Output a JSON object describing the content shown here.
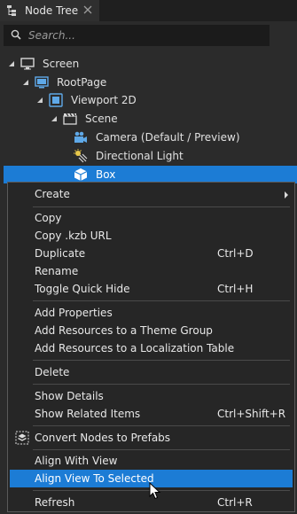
{
  "tab": {
    "title": "Node Tree"
  },
  "search": {
    "placeholder": "Search..."
  },
  "tree": [
    {
      "label": "Screen",
      "icon": "monitor-icon"
    },
    {
      "label": "RootPage",
      "icon": "page-icon"
    },
    {
      "label": "Viewport 2D",
      "icon": "viewport-icon"
    },
    {
      "label": "Scene",
      "icon": "scene-icon"
    },
    {
      "label": "Camera (Default / Preview)",
      "icon": "camera-icon"
    },
    {
      "label": "Directional Light",
      "icon": "light-icon"
    },
    {
      "label": "Box",
      "icon": "box-icon",
      "selected": true
    }
  ],
  "menu": {
    "create": "Create",
    "copy": "Copy",
    "copy_kzb_url": "Copy .kzb URL",
    "duplicate": "Duplicate",
    "duplicate_shortcut": "Ctrl+D",
    "rename": "Rename",
    "toggle_quick_hide": "Toggle Quick Hide",
    "toggle_quick_hide_shortcut": "Ctrl+H",
    "add_properties": "Add Properties",
    "add_resources_theme": "Add Resources to a Theme Group",
    "add_resources_localization": "Add Resources to a Localization Table",
    "delete": "Delete",
    "show_details": "Show Details",
    "show_related_items": "Show Related Items",
    "show_related_items_shortcut": "Ctrl+Shift+R",
    "convert_nodes_to_prefabs": "Convert Nodes to Prefabs",
    "align_with_view": "Align With View",
    "align_view_to_selected": "Align View To Selected",
    "refresh": "Refresh",
    "refresh_shortcut": "Ctrl+R"
  },
  "colors": {
    "selection": "#1c7cd5",
    "background": "#2b2b2b",
    "menu_bg": "#262626"
  }
}
